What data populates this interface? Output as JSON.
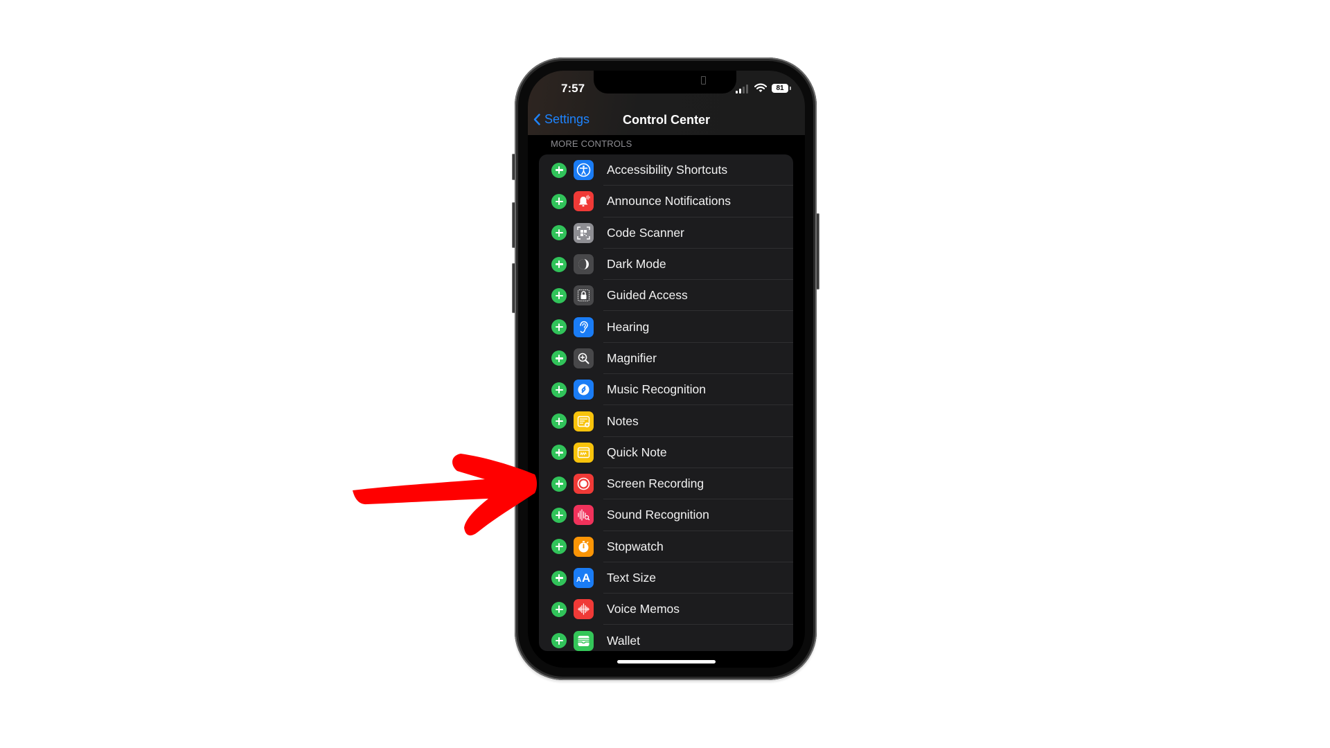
{
  "status_bar": {
    "time": "7:57",
    "battery_level": "81",
    "signal_bars_active": 2,
    "signal_bars_total": 4,
    "wifi_icon": "wifi-icon"
  },
  "nav": {
    "back_label": "Settings",
    "back_icon": "chevron-left-icon",
    "title": "Control Center"
  },
  "section": {
    "header": "MORE CONTROLS"
  },
  "controls": [
    {
      "label": "Accessibility Shortcuts",
      "icon": "accessibility-icon",
      "color": "#1a7cf5"
    },
    {
      "label": "Announce Notifications",
      "icon": "bell-icon",
      "color": "#f03a37"
    },
    {
      "label": "Code Scanner",
      "icon": "qr-code-icon",
      "color": "#8e8e93"
    },
    {
      "label": "Dark Mode",
      "icon": "dark-mode-icon",
      "color": "#48484a"
    },
    {
      "label": "Guided Access",
      "icon": "lock-icon",
      "color": "#48484a"
    },
    {
      "label": "Hearing",
      "icon": "ear-icon",
      "color": "#1a7cf5"
    },
    {
      "label": "Magnifier",
      "icon": "magnifier-icon",
      "color": "#48484a"
    },
    {
      "label": "Music Recognition",
      "icon": "shazam-icon",
      "color": "#1a7cf5"
    },
    {
      "label": "Notes",
      "icon": "notes-icon",
      "color": "#f8c30c"
    },
    {
      "label": "Quick Note",
      "icon": "quick-note-icon",
      "color": "#f8c30c"
    },
    {
      "label": "Screen Recording",
      "icon": "record-icon",
      "color": "#f03a37"
    },
    {
      "label": "Sound Recognition",
      "icon": "sound-recognition-icon",
      "color": "#f0325b"
    },
    {
      "label": "Stopwatch",
      "icon": "stopwatch-icon",
      "color": "#fb9506"
    },
    {
      "label": "Text Size",
      "icon": "text-size-icon",
      "color": "#1a7cf5"
    },
    {
      "label": "Voice Memos",
      "icon": "waveform-icon",
      "color": "#f03a37"
    },
    {
      "label": "Wallet",
      "icon": "wallet-icon",
      "color": "#34c659"
    }
  ],
  "annotation": {
    "arrow_color": "#ff0000",
    "points_to": "Screen Recording"
  },
  "colors": {
    "accent": "#1e84ff",
    "add_button": "#31c35a"
  }
}
